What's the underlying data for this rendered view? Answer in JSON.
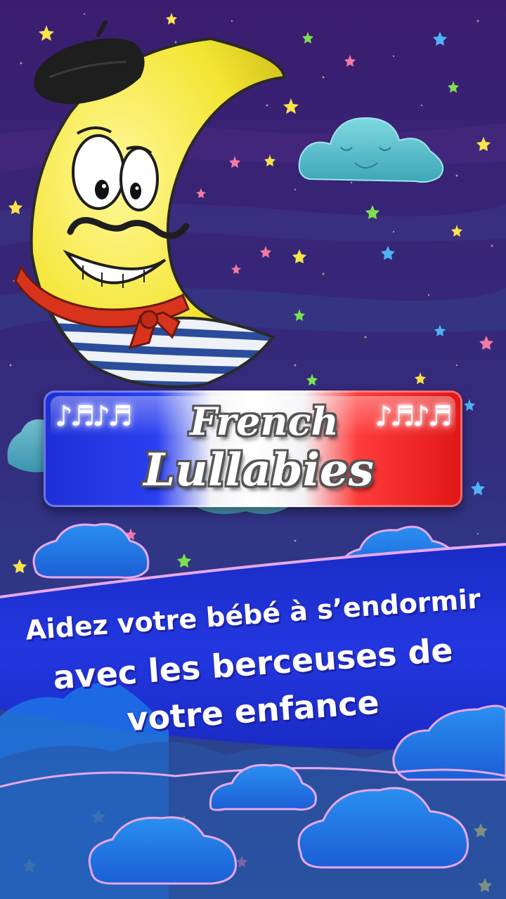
{
  "banner": {
    "title_line1": "French",
    "title_line2": "Lullabies",
    "notes_left": "♪♬♪♬",
    "notes_right": "♪♬♪♬"
  },
  "tagline": {
    "line1": "Aidez  votre bébé à s’endormir",
    "line2": "avec les berceuses de",
    "line3": "votre enfance"
  },
  "colors": {
    "sky_top": "#3a1e6e",
    "sky_bottom": "#2c3c8a",
    "ribbon_blue": "#1f2fd0",
    "moon_yellow": "#f6ea3a",
    "scarf_red": "#d8341d",
    "flag_blue": "#1e2fd6",
    "flag_white": "#ffffff",
    "flag_red": "#e01616"
  },
  "illustration": {
    "character": "moon-with-beret-icon",
    "cloud": "sleeping-cloud-icon",
    "stars": "star-icon"
  }
}
